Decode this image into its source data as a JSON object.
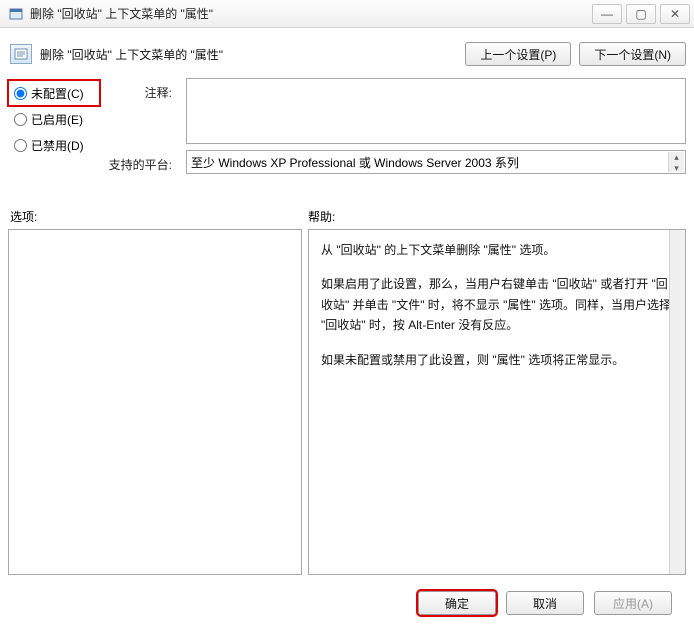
{
  "window": {
    "title": "删除 \"回收站\" 上下文菜单的 \"属性\"",
    "min_icon": "—",
    "max_icon": "▢",
    "close_icon": "✕"
  },
  "header": {
    "title": "删除 \"回收站\" 上下文菜单的 \"属性\"",
    "prev_btn": "上一个设置(P)",
    "next_btn": "下一个设置(N)"
  },
  "radios": {
    "not_configured": "未配置(C)",
    "enabled": "已启用(E)",
    "disabled": "已禁用(D)"
  },
  "labels": {
    "comment": "注释:",
    "platform": "支持的平台:",
    "options": "选项:",
    "help": "帮助:"
  },
  "fields": {
    "comment_value": "",
    "platform_value": "至少 Windows XP Professional 或 Windows Server 2003 系列"
  },
  "help_text": {
    "p1": "从 \"回收站\" 的上下文菜单删除 \"属性\" 选项。",
    "p2": "如果启用了此设置，那么，当用户右键单击 \"回收站\" 或者打开 \"回收站\" 并单击 \"文件\" 时，将不显示 \"属性\" 选项。同样，当用户选择 \"回收站\" 时，按 Alt-Enter 没有反应。",
    "p3": "如果未配置或禁用了此设置，则 \"属性\" 选项将正常显示。"
  },
  "footer": {
    "ok": "确定",
    "cancel": "取消",
    "apply": "应用(A)"
  }
}
